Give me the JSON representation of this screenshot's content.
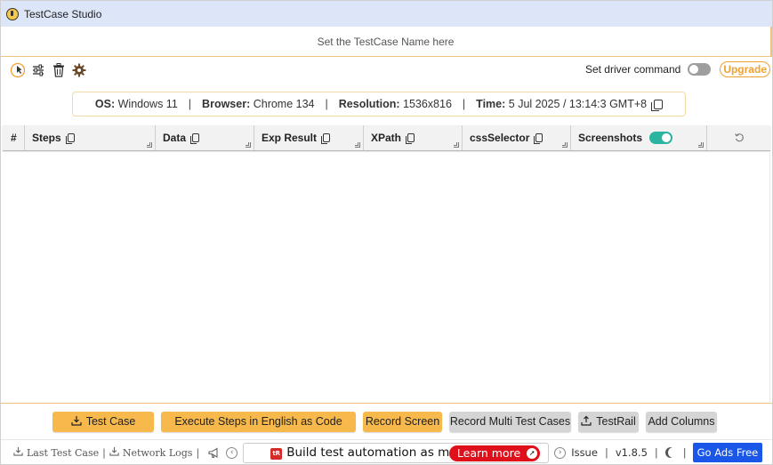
{
  "window": {
    "title": "TestCase Studio"
  },
  "name_input": {
    "placeholder": "Set the TestCase Name here"
  },
  "toolbar": {
    "icons": [
      "pointer-icon",
      "sliders-icon",
      "trash-icon",
      "gear-icon"
    ],
    "driver_label": "Set driver command",
    "driver_toggle_on": false,
    "upgrade_label": "Upgrade"
  },
  "info": {
    "os_label": "OS:",
    "os_value": "Windows 11",
    "browser_label": "Browser:",
    "browser_value": "Chrome 134",
    "resolution_label": "Resolution:",
    "resolution_value": "1536x816",
    "time_label": "Time:",
    "time_value": "5 Jul 2025 / 13:14:3 GMT+8",
    "separator": "|"
  },
  "table": {
    "columns": [
      {
        "label": "#"
      },
      {
        "label": "Steps"
      },
      {
        "label": "Data"
      },
      {
        "label": "Exp Result"
      },
      {
        "label": "XPath"
      },
      {
        "label": "cssSelector"
      },
      {
        "label": "Screenshots",
        "toggle_on": true
      }
    ],
    "rows": []
  },
  "actions": {
    "test_case": "Test Case",
    "execute_english": "Execute Steps in English as Code",
    "record_screen": "Record Screen",
    "record_multi": "Record Multi Test Cases",
    "testrail": "TestRail",
    "add_columns": "Add Columns"
  },
  "footer": {
    "last_test_case": "Last Test Case",
    "network_logs": "Network Logs",
    "separator": "|",
    "ad_logo": "tR",
    "ad_text": "Build test automation as m",
    "learn_more": "Learn more",
    "issue": "Issue",
    "version": "v1.8.5",
    "ads_free": "Go Ads Free"
  },
  "colors": {
    "accent_orange": "#f7b84c",
    "toggle_on": "#2bb5a0",
    "ads_free_blue": "#1a56e8",
    "learn_more_red": "#e0101a",
    "titlebar": "#dce6f8"
  }
}
